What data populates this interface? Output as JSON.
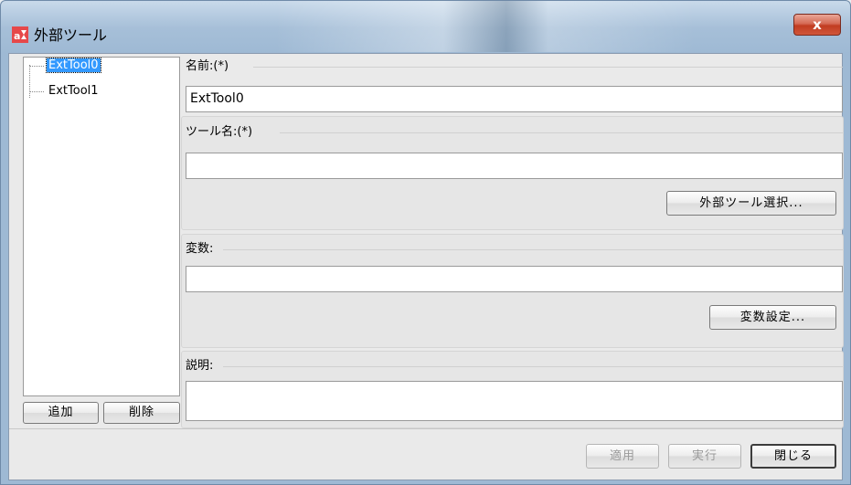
{
  "window": {
    "title": "外部ツール",
    "close_label": "x"
  },
  "tree": {
    "items": [
      {
        "label": "ExtTool0",
        "selected": true
      },
      {
        "label": "ExtTool1",
        "selected": false
      }
    ],
    "add_label": "追加",
    "delete_label": "削除"
  },
  "form": {
    "name_label": "名前:(*)",
    "name_value": "ExtTool0",
    "tool_label": "ツール名:(*)",
    "tool_value": "",
    "tool_select_label": "外部ツール選択...",
    "var_label": "変数:",
    "var_value": "",
    "var_settings_label": "変数設定...",
    "desc_label": "説明:",
    "desc_value": ""
  },
  "footer": {
    "apply_label": "適用",
    "run_label": "実行",
    "close_label": "閉じる"
  },
  "colors": {
    "selection": "#3399ff",
    "close_button": "#c13c21"
  }
}
